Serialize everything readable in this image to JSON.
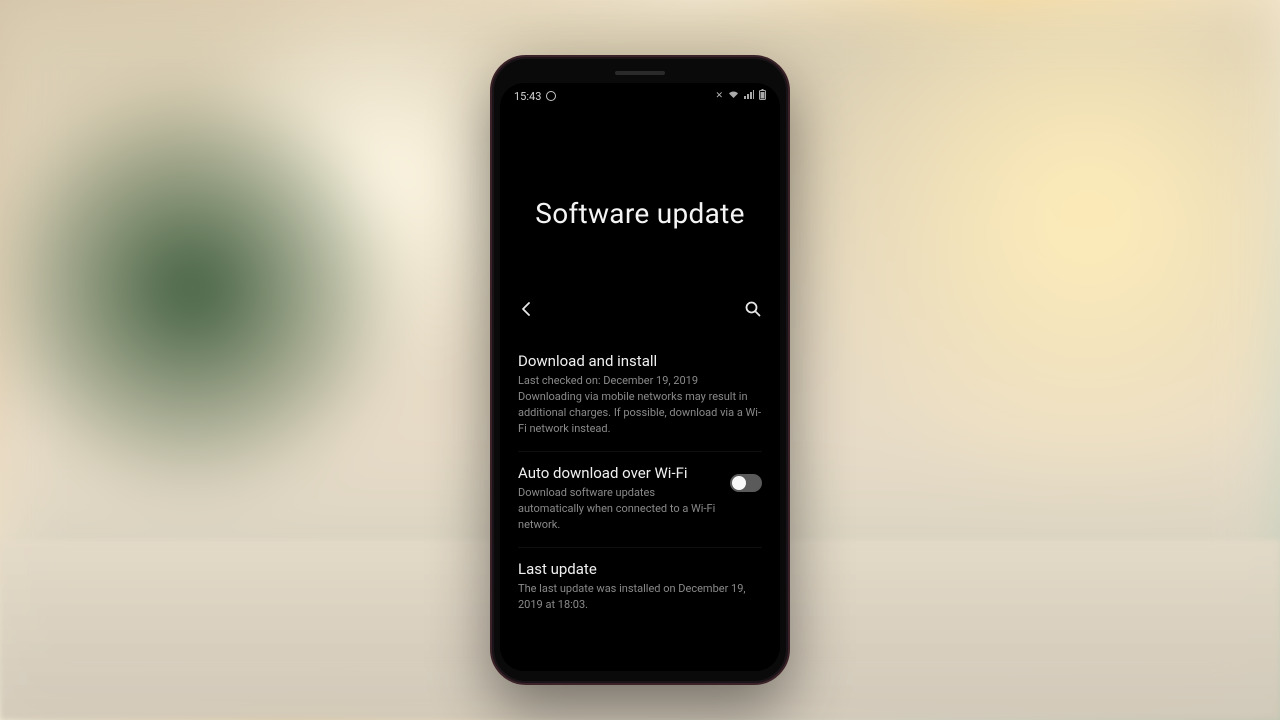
{
  "statusBar": {
    "time": "15:43",
    "icons": {
      "alarm": "alarm",
      "vibrate": "vibrate",
      "wifi": "wifi",
      "signal": "signal",
      "battery": "battery"
    }
  },
  "header": {
    "title": "Software update"
  },
  "settings": {
    "download": {
      "title": "Download and install",
      "lastChecked": "Last checked on: December 19, 2019",
      "warning": "Downloading via mobile networks may result in additional charges. If possible, download via a Wi-Fi network instead."
    },
    "autoDownload": {
      "title": "Auto download over Wi-Fi",
      "description": "Download software updates automatically when connected to a Wi-Fi network.",
      "enabled": false
    },
    "lastUpdate": {
      "title": "Last update",
      "description": "The last update was installed on December 19, 2019 at 18:03."
    }
  }
}
